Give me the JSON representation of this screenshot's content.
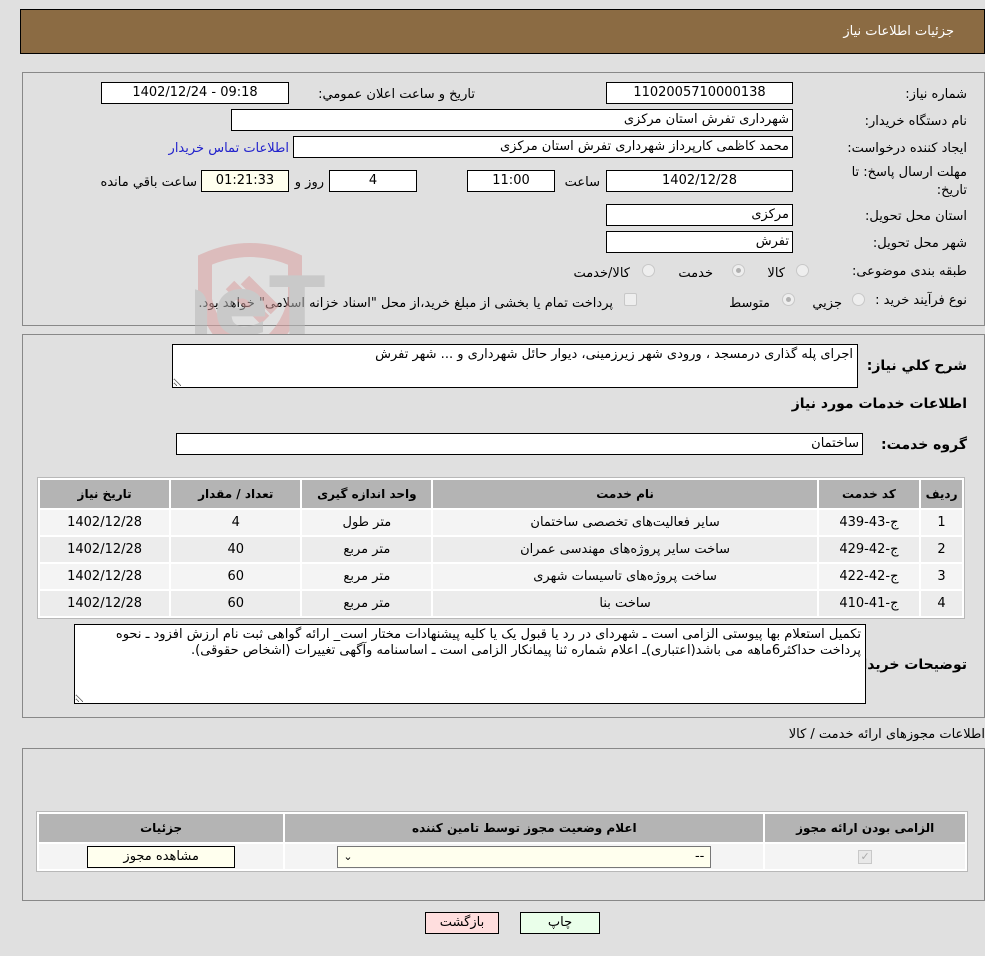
{
  "header": {
    "title": "جزئیات اطلاعات نیاز"
  },
  "form": {
    "need_number_label": "شماره نیاز:",
    "need_number": "1102005710000138",
    "announce_label": "تاریخ و ساعت اعلان عمومي:",
    "announce_value": "1402/12/24 - 09:18",
    "buyer_org_label": "نام دستگاه خریدار:",
    "buyer_org": "شهرداری تفرش استان مرکزی",
    "creator_label": "ایجاد کننده درخواست:",
    "creator": "محمد کاظمی کارپرداز شهرداری تفرش استان مرکزی",
    "contact_link": "اطلاعات تماس خریدار",
    "deadline_label": "مهلت ارسال پاسخ: تا تاریخ:",
    "deadline_date": "1402/12/28",
    "time_label": "ساعت",
    "deadline_time": "11:00",
    "days_value": "4",
    "days_label": "روز و",
    "remaining_time": "01:21:33",
    "remaining_label": "ساعت باقي مانده",
    "province_label": "استان محل تحویل:",
    "province": "مرکزی",
    "city_label": "شهر محل تحویل:",
    "city": "تفرش",
    "category_label": "طبقه بندی موضوعی:",
    "category_options": [
      {
        "label": "کالا",
        "selected": false
      },
      {
        "label": "خدمت",
        "selected": true
      },
      {
        "label": "کالا/خدمت",
        "selected": false
      }
    ],
    "process_label": "نوع فرآیند خرید :",
    "process_options": [
      {
        "label": "جزيي",
        "selected": false
      },
      {
        "label": "متوسط",
        "selected": true
      }
    ],
    "treasury_note": "پرداخت تمام یا بخشی از مبلغ خرید،از محل \"اسناد خزانه اسلامی\" خواهد بود.",
    "treasury_checked": false
  },
  "description": {
    "label": "شرح کلي نیاز:",
    "text": "اجرای پله گذاری درمسجد ، ورودی شهر زیرزمینی، دیوار حائل شهرداری و ... شهر تفرش"
  },
  "services": {
    "section_title": "اطلاعات خدمات مورد نیاز",
    "group_label": "گروه خدمت:",
    "group_value": "ساختمان",
    "columns": [
      "ردیف",
      "کد خدمت",
      "نام خدمت",
      "واحد اندازه گیری",
      "تعداد / مقدار",
      "تاریخ نیاز"
    ],
    "rows": [
      {
        "idx": "1",
        "code": "ج-43-439",
        "name": "سایر فعالیت‌های تخصصی ساختمان",
        "unit": "متر طول",
        "qty": "4",
        "date": "1402/12/28"
      },
      {
        "idx": "2",
        "code": "ج-42-429",
        "name": "ساخت سایر پروژه‌های مهندسی عمران",
        "unit": "متر مربع",
        "qty": "40",
        "date": "1402/12/28"
      },
      {
        "idx": "3",
        "code": "ج-42-422",
        "name": "ساخت پروژه‌های تاسیسات شهری",
        "unit": "متر مربع",
        "qty": "60",
        "date": "1402/12/28"
      },
      {
        "idx": "4",
        "code": "ج-41-410",
        "name": "ساخت بنا",
        "unit": "متر مربع",
        "qty": "60",
        "date": "1402/12/28"
      }
    ]
  },
  "buyer_notes": {
    "label": "توضیحات خریدار:",
    "text": "تکمیل استعلام بها پیوستی الزامی است ـ شهردای در رد یا قبول یک یا کلیه پیشنهادات مختار است_ ارائه گواهی ثبت نام ارزش افزود ـ نحوه پرداخت حداکثر6ماهه می باشد(اعتباری)ـ اعلام شماره ثنا پیمانکار الزامی است ـ اساسنامه وآگهی تغییرات (اشخاص حقوقی)."
  },
  "permits": {
    "section_title": "اطلاعات مجوزهای ارائه خدمت / کالا",
    "columns": [
      "الزامی بودن ارائه مجوز",
      "اعلام وضعیت مجوز توسط تامین کننده",
      "جزئیات"
    ],
    "row": {
      "required_checked": true,
      "status_selected": "--",
      "details_button": "مشاهده مجوز"
    }
  },
  "actions": {
    "print_label": "چاپ",
    "back_label": "بازگشت"
  },
  "watermark": {
    "text": "AriaTender.neT"
  }
}
